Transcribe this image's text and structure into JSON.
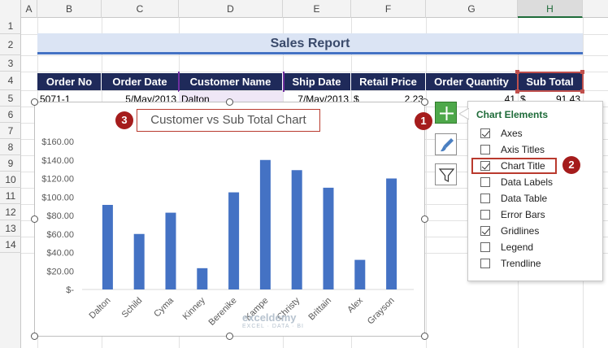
{
  "sheet": {
    "columns": [
      "A",
      "B",
      "C",
      "D",
      "E",
      "F",
      "G",
      "H"
    ],
    "rows": [
      "1",
      "2",
      "3",
      "4",
      "5",
      "6",
      "7",
      "8",
      "9",
      "10",
      "11",
      "12",
      "13",
      "14"
    ],
    "title": "Sales Report",
    "headers": [
      "Order No",
      "Order Date",
      "Customer Name",
      "Ship Date",
      "Retail Price",
      "Order Quantity",
      "Sub Total"
    ],
    "row5": {
      "order_no": "5071-1",
      "order_date": "5/May/2013",
      "customer": "Dalton",
      "ship_date": "7/May/2013",
      "price_symbol": "$",
      "price_value": "2.23",
      "quantity": "41",
      "sub_symbol": "$",
      "sub_value": "91.43"
    }
  },
  "chart": {
    "title": "Customer vs Sub Total Chart",
    "badge_title": "3"
  },
  "chart_data": {
    "type": "bar",
    "title": "Customer vs Sub Total Chart",
    "categories": [
      "Dalton",
      "Schild",
      "Cyma",
      "Kinney",
      "Berenike",
      "Kampe",
      "Christy",
      "Brittain",
      "Alex",
      "Grayson"
    ],
    "values": [
      91.43,
      60,
      83,
      23,
      105,
      140,
      129,
      110,
      32,
      120
    ],
    "y_ticks": [
      "$-",
      "$20.00",
      "$40.00",
      "$60.00",
      "$80.00",
      "$100.00",
      "$120.00",
      "$140.00",
      "$160.00"
    ],
    "ylim": [
      0,
      160
    ],
    "grid": false,
    "legend": "none",
    "bar_color": "#4472c4"
  },
  "side_buttons": {
    "badge_add": "1",
    "add_icon": "plus-icon",
    "style_icon": "brush-icon",
    "filter_icon": "funnel-icon"
  },
  "panel": {
    "heading": "Chart Elements",
    "badge_chart_title": "2",
    "options": [
      {
        "label": "Axes",
        "checked": true
      },
      {
        "label": "Axis Titles",
        "checked": false
      },
      {
        "label": "Chart Title",
        "checked": true
      },
      {
        "label": "Data Labels",
        "checked": false
      },
      {
        "label": "Data Table",
        "checked": false
      },
      {
        "label": "Error Bars",
        "checked": false
      },
      {
        "label": "Gridlines",
        "checked": true
      },
      {
        "label": "Legend",
        "checked": false
      },
      {
        "label": "Trendline",
        "checked": false
      }
    ]
  },
  "watermark": {
    "name": "exceldemy",
    "tagline": "EXCEL · DATA · BI"
  },
  "colors": {
    "header_bg": "#1f2a5a",
    "title_bg": "#dbe4f4",
    "accent": "#4472c4",
    "highlight": "#b93a2e",
    "badge": "#a51c1c"
  }
}
